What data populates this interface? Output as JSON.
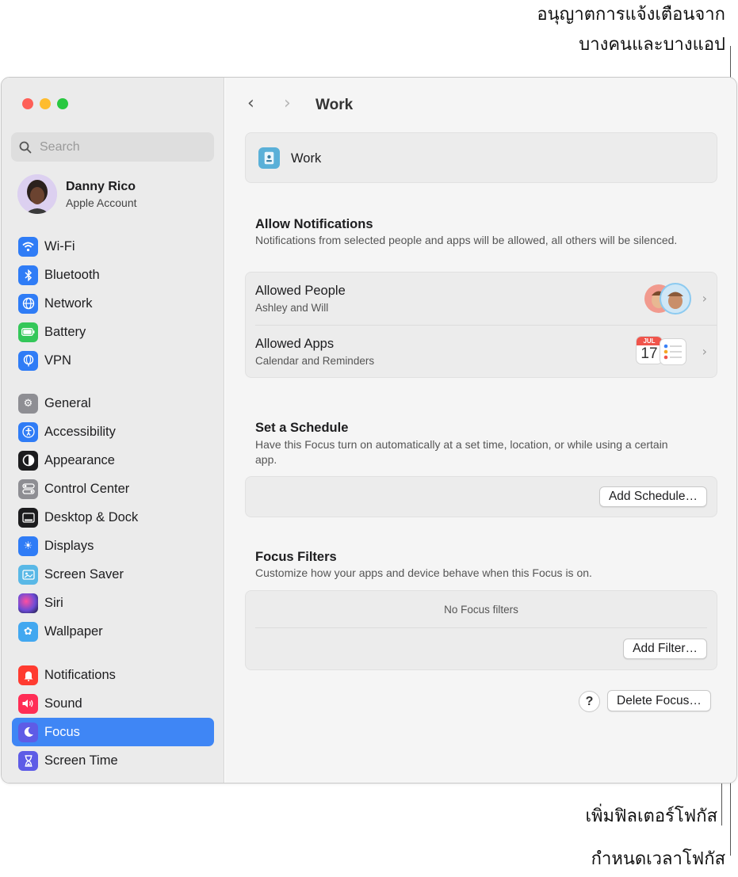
{
  "callouts": {
    "allow_notifications_line1": "อนุญาตการแจ้งเตือนจาก",
    "allow_notifications_line2": "บางคนและบางแอป",
    "add_filter": "เพิ่มฟิลเตอร์โฟกัส",
    "set_schedule": "กำหนดเวลาโฟกัส"
  },
  "window": {
    "traffic_lights": [
      "#fe5f57",
      "#febc2e",
      "#28c840"
    ]
  },
  "sidebar": {
    "search_placeholder": "Search",
    "account": {
      "name": "Danny Rico",
      "subtitle": "Apple Account"
    },
    "groups": [
      [
        {
          "label": "Wi-Fi",
          "icon": "wifi-icon",
          "color": "#2f7cf6"
        },
        {
          "label": "Bluetooth",
          "icon": "bluetooth-icon",
          "color": "#2f7cf6"
        },
        {
          "label": "Network",
          "icon": "globe-icon",
          "color": "#2f7cf6"
        },
        {
          "label": "Battery",
          "icon": "battery-icon",
          "color": "#34c759"
        },
        {
          "label": "VPN",
          "icon": "vpn-icon",
          "color": "#2f7cf6"
        }
      ],
      [
        {
          "label": "General",
          "icon": "gear-icon",
          "color": "#8e8e93"
        },
        {
          "label": "Accessibility",
          "icon": "accessibility-icon",
          "color": "#2f7cf6"
        },
        {
          "label": "Appearance",
          "icon": "appearance-icon",
          "color": "#1c1c1e"
        },
        {
          "label": "Control Center",
          "icon": "control-center-icon",
          "color": "#8e8e93"
        },
        {
          "label": "Desktop & Dock",
          "icon": "dock-icon",
          "color": "#1c1c1e"
        },
        {
          "label": "Displays",
          "icon": "sun-icon",
          "color": "#2f7cf6"
        },
        {
          "label": "Screen Saver",
          "icon": "screen-saver-icon",
          "color": "#59b8e6"
        },
        {
          "label": "Siri",
          "icon": "siri-icon",
          "color": "#6c4bd6"
        },
        {
          "label": "Wallpaper",
          "icon": "flower-icon",
          "color": "#42a8f0"
        }
      ],
      [
        {
          "label": "Notifications",
          "icon": "bell-icon",
          "color": "#ff3b30"
        },
        {
          "label": "Sound",
          "icon": "speaker-icon",
          "color": "#ff2d55"
        },
        {
          "label": "Focus",
          "icon": "moon-icon",
          "color": "#5e5ce6",
          "active": true
        },
        {
          "label": "Screen Time",
          "icon": "hourglass-icon",
          "color": "#5e5ce6"
        }
      ]
    ]
  },
  "main": {
    "title": "Work",
    "focus_name": "Work",
    "allow_notifications": {
      "title": "Allow Notifications",
      "description": "Notifications from selected people and apps will be allowed, all others will be silenced.",
      "people": {
        "title": "Allowed People",
        "subtitle": "Ashley and Will"
      },
      "apps": {
        "title": "Allowed Apps",
        "subtitle": "Calendar and Reminders",
        "calendar_month": "JUL",
        "calendar_day": "17"
      }
    },
    "schedule": {
      "title": "Set a Schedule",
      "description": "Have this Focus turn on automatically at a set time, location, or while using a certain app.",
      "button": "Add Schedule…"
    },
    "filters": {
      "title": "Focus Filters",
      "description": "Customize how your apps and device behave when this Focus is on.",
      "empty": "No Focus filters",
      "button": "Add Filter…"
    },
    "help_label": "?",
    "delete_button": "Delete Focus…"
  }
}
